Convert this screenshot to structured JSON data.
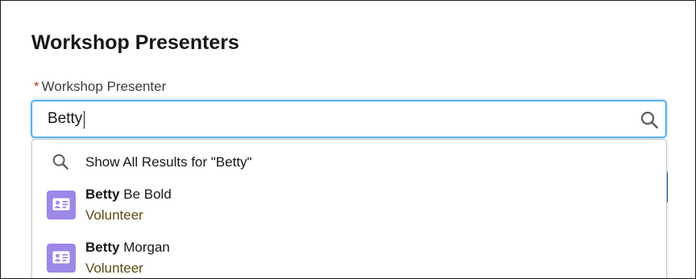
{
  "modal": {
    "title": "Workshop Presenters"
  },
  "field": {
    "required_marker": "*",
    "label": "Workshop Presenter",
    "value": "Betty",
    "search_icon": "search-icon"
  },
  "dropdown": {
    "show_all_text": "Show All Results for \"Betty\"",
    "show_all_icon": "search-icon",
    "results": [
      {
        "match": "Betty",
        "rest": " Be Bold",
        "type": "Volunteer",
        "icon": "contact-card-icon",
        "icon_color": "#9d87e8"
      },
      {
        "match": "Betty",
        "rest": " Morgan",
        "type": "Volunteer",
        "icon": "contact-card-icon",
        "icon_color": "#9d87e8"
      }
    ]
  },
  "colors": {
    "focus_border": "#1b96ff",
    "required": "#c23934",
    "secondary_text": "#5c4a12",
    "backdrop": "#6b6b6b"
  }
}
